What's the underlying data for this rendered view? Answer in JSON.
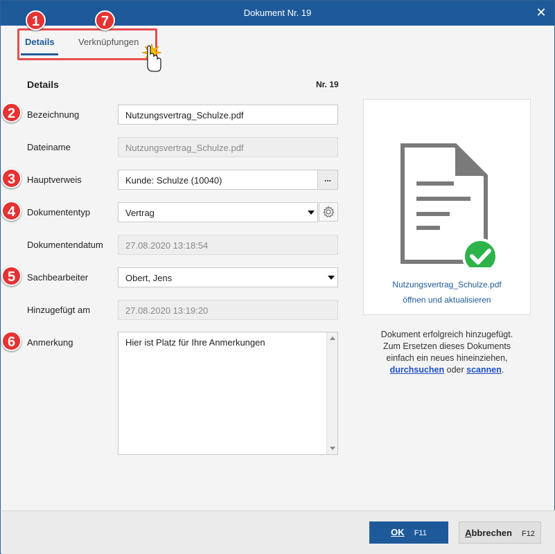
{
  "window": {
    "title": "Dokument Nr. 19",
    "close_icon": "close-icon"
  },
  "tabs": [
    {
      "label": "Details",
      "active": true
    },
    {
      "label": "Verknüpfungen",
      "active": false
    }
  ],
  "badges": [
    "1",
    "7",
    "2",
    "3",
    "4",
    "5",
    "6"
  ],
  "section": {
    "title": "Details",
    "number": "Nr. 19"
  },
  "form": {
    "bezeichnung": {
      "label": "Bezeichnung",
      "value": "Nutzungsvertrag_Schulze.pdf"
    },
    "dateiname": {
      "label": "Dateiname",
      "value": "Nutzungsvertrag_Schulze.pdf"
    },
    "hauptverweis": {
      "label": "Hauptverweis",
      "value": "Kunde: Schulze (10040)",
      "button": "..."
    },
    "dokumententyp": {
      "label": "Dokumententyp",
      "value": "Vertrag"
    },
    "dokumentendatum": {
      "label": "Dokumentendatum",
      "value": "27.08.2020 13:18:54"
    },
    "sachbearbeiter": {
      "label": "Sachbearbeiter",
      "value": "Obert, Jens"
    },
    "hinzugefuegt": {
      "label": "Hinzugefügt am",
      "value": "27.08.2020 13:19:20"
    },
    "anmerkung": {
      "label": "Anmerkung",
      "value": "Hier ist Platz für Ihre Anmerkungen"
    }
  },
  "preview": {
    "filename": "Nutzungsvertrag_Schulze.pdf",
    "action": "öffnen und aktualisieren",
    "status_line1": "Dokument erfolgreich hinzugefügt.",
    "status_line2": "Zum Ersetzen dieses Dokuments",
    "status_line3": "einfach ein neues hineinziehen,",
    "link_browse": "durchsuchen",
    "connector": "oder",
    "link_scan": "scannen",
    "end": "."
  },
  "footer": {
    "ok_mnemonic": "O",
    "ok_rest": "K",
    "ok_shortcut": "F11",
    "cancel_mnemonic": "A",
    "cancel_rest": "bbrechen",
    "cancel_shortcut": "F12"
  },
  "colors": {
    "accent": "#1e5a9a",
    "badge": "#e63232",
    "success": "#2db34a"
  }
}
